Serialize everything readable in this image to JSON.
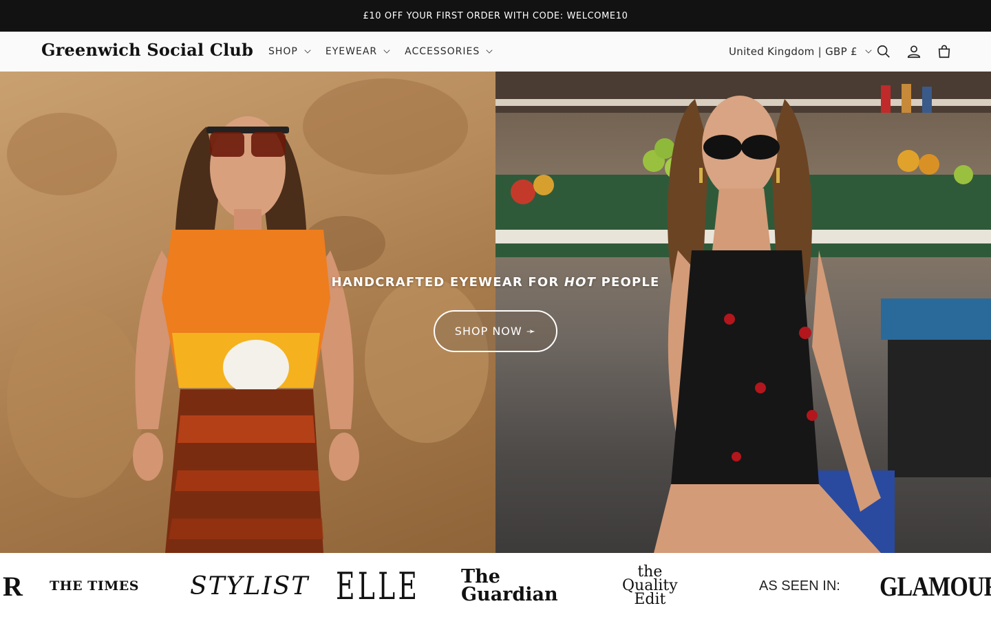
{
  "announcement": "£10 OFF YOUR FIRST ORDER WITH CODE: WELCOME10",
  "header": {
    "logo": "Greenwich Social Club",
    "nav": [
      {
        "label": "SHOP"
      },
      {
        "label": "EYEWEAR"
      },
      {
        "label": "ACCESSORIES"
      }
    ],
    "country_selector": "United Kingdom | GBP £",
    "icons": [
      "search-icon",
      "account-icon",
      "cart-icon"
    ]
  },
  "hero": {
    "title_part1": "HANDCRAFTED EYEWEAR FOR ",
    "title_emphasis": "HOT",
    "title_part2": " PEOPLE",
    "cta_label": "SHOP NOW ➛",
    "left_image": "model in orange sunset top and sunglasses against sandstone rock",
    "right_image": "model in black cherry dress and oval sunglasses at fruit market"
  },
  "press": {
    "logos": [
      {
        "name": "R",
        "text": "R"
      },
      {
        "name": "The Times",
        "text": "THE TIMES"
      },
      {
        "name": "Stylist",
        "text": "STYLIST"
      },
      {
        "name": "Elle",
        "text": "ELLE"
      },
      {
        "name": "The Guardian",
        "text_line1": "The",
        "text_line2": "Guardian"
      },
      {
        "name": "The Quality Edit",
        "text_line1": "the",
        "text_line2": "Quality",
        "text_line3": "Edit"
      },
      {
        "name": "As Seen In",
        "text": "AS SEEN IN:"
      },
      {
        "name": "Glamour",
        "text": "GLAMOUR"
      }
    ]
  },
  "colors": {
    "announcement_bg": "#121212",
    "header_bg": "#fafafa",
    "text": "#121212",
    "cta_border": "#ffffff"
  }
}
